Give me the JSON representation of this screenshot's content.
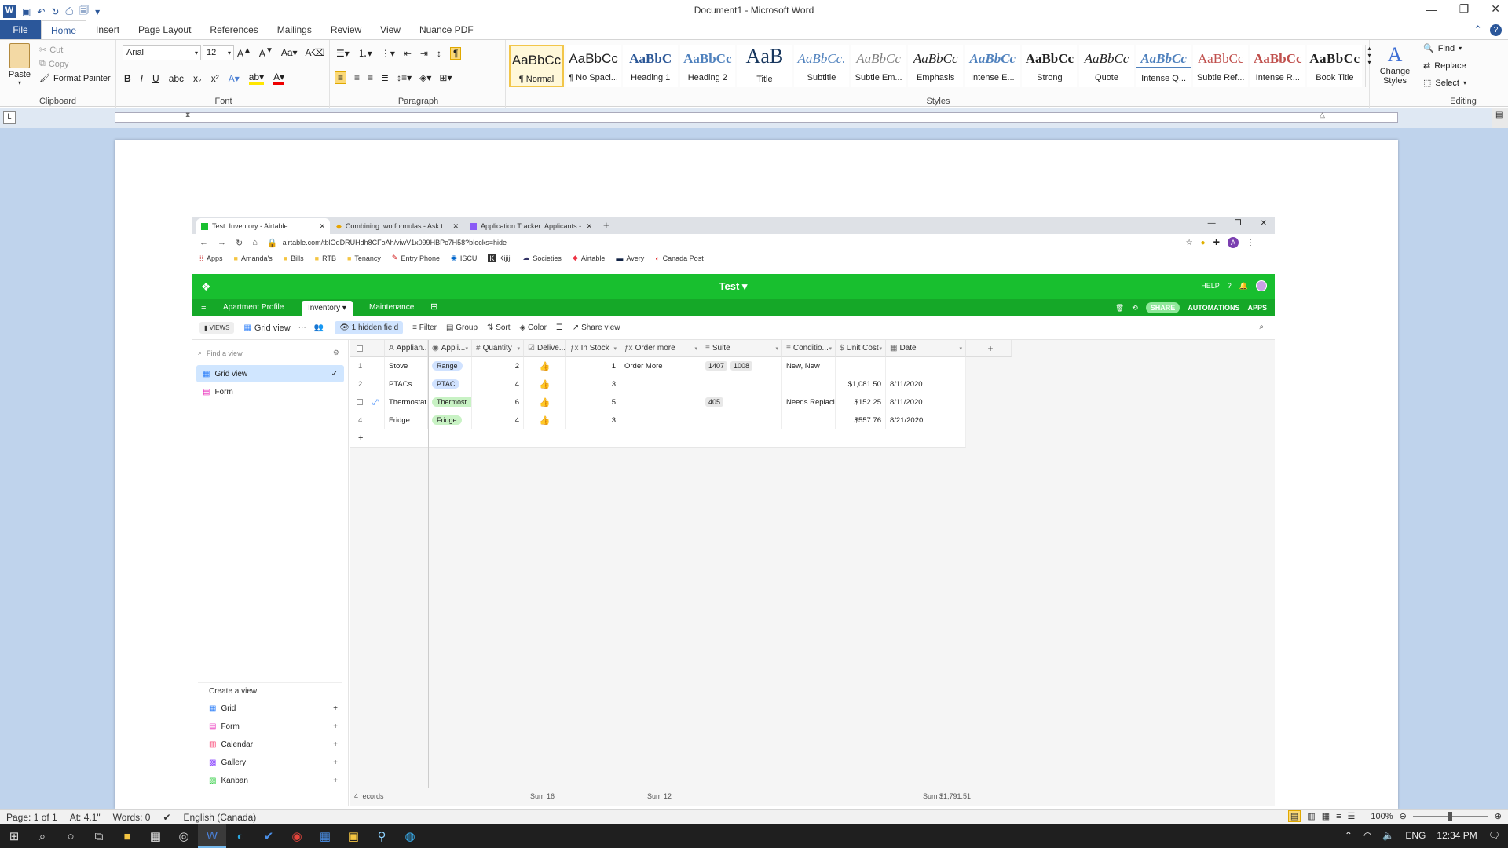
{
  "word": {
    "title": "Document1  -  Microsoft Word",
    "tabs": [
      "File",
      "Home",
      "Insert",
      "Page Layout",
      "References",
      "Mailings",
      "Review",
      "View",
      "Nuance PDF"
    ],
    "clipboard": {
      "paste": "Paste",
      "cut": "Cut",
      "copy": "Copy",
      "format_painter": "Format Painter",
      "label": "Clipboard"
    },
    "font": {
      "name": "Arial",
      "size": "12",
      "label": "Font"
    },
    "paragraph": {
      "label": "Paragraph"
    },
    "styles": {
      "label": "Styles",
      "items": [
        {
          "preview": "AaBbCc",
          "name": "¶ Normal"
        },
        {
          "preview": "AaBbCc",
          "name": "¶ No Spaci..."
        },
        {
          "preview": "AaBbC",
          "name": "Heading 1"
        },
        {
          "preview": "AaBbCc",
          "name": "Heading 2"
        },
        {
          "preview": "AaB",
          "name": "Title"
        },
        {
          "preview": "AaBbCc.",
          "name": "Subtitle"
        },
        {
          "preview": "AaBbCc",
          "name": "Subtle Em..."
        },
        {
          "preview": "AaBbCc",
          "name": "Emphasis"
        },
        {
          "preview": "AaBbCc",
          "name": "Intense E..."
        },
        {
          "preview": "AaBbCc",
          "name": "Strong"
        },
        {
          "preview": "AaBbCc",
          "name": "Quote"
        },
        {
          "preview": "AaBbCc",
          "name": "Intense Q..."
        },
        {
          "preview": "AaBbCc",
          "name": "Subtle Ref..."
        },
        {
          "preview": "AaBbCc",
          "name": "Intense R..."
        },
        {
          "preview": "AaBbCc",
          "name": "Book Title"
        }
      ]
    },
    "change_styles": "Change Styles",
    "editing": {
      "find": "Find",
      "replace": "Replace",
      "select": "Select",
      "label": "Editing"
    },
    "status": {
      "page": "Page: 1 of 1",
      "at": "At: 4.1\"",
      "words": "Words: 0",
      "language": "English (Canada)",
      "zoom": "100%"
    },
    "taskbar": {
      "lang": "ENG",
      "time": "12:34 PM"
    }
  },
  "browser": {
    "tabs": [
      "Test: Inventory - Airtable",
      "Combining two formulas - Ask t",
      "Application Tracker: Applicants -"
    ],
    "url": "airtable.com/tblOdDRUHdh8CFoAh/viwV1x099HBPc7H58?blocks=hide",
    "avatar": "A",
    "bookmarks": [
      "Apps",
      "Amanda's",
      "Bills",
      "RTB",
      "Tenancy",
      "Entry Phone",
      "ISCU",
      "Kijiji",
      "Societies",
      "Airtable",
      "Avery",
      "Canada Post"
    ]
  },
  "airtable": {
    "base_name": "Test",
    "help": "HELP",
    "tables": [
      "Apartment Profile",
      "Inventory",
      "Maintenance"
    ],
    "share": "SHARE",
    "automations": "AUTOMATIONS",
    "apps": "APPS",
    "views_label": "VIEWS",
    "view_name": "Grid view",
    "toolbar": {
      "hidden": "1 hidden field",
      "filter": "Filter",
      "group": "Group",
      "sort": "Sort",
      "color": "Color",
      "share_view": "Share view"
    },
    "find_view_placeholder": "Find a view",
    "views": [
      "Grid view",
      "Form"
    ],
    "create_view_label": "Create a view",
    "create_views": [
      "Grid",
      "Form",
      "Calendar",
      "Gallery",
      "Kanban"
    ],
    "columns": [
      "Applian...",
      "Appli...",
      "Quantity",
      "Delive...",
      "In Stock",
      "Order more",
      "Suite",
      "Conditio...",
      "Unit Cost",
      "Date"
    ],
    "rows": [
      {
        "n": "1",
        "name": "Stove",
        "type": "Range",
        "qty": "2",
        "in_stock": "1",
        "order": "Order More",
        "suite": [
          "1407",
          "1008"
        ],
        "cond": "New, New",
        "cost": "",
        "date": ""
      },
      {
        "n": "2",
        "name": "PTACs",
        "type": "PTAC",
        "qty": "4",
        "in_stock": "3",
        "order": "",
        "suite": [],
        "cond": "",
        "cost": "$1,081.50",
        "date": "8/11/2020"
      },
      {
        "n": "",
        "name": "Thermostat",
        "type": "Thermost...",
        "qty": "6",
        "in_stock": "5",
        "order": "",
        "suite": [
          "405"
        ],
        "cond": "Needs Replacing",
        "cost": "$152.25",
        "date": "8/11/2020"
      },
      {
        "n": "4",
        "name": "Fridge",
        "type": "Fridge",
        "qty": "4",
        "in_stock": "3",
        "order": "",
        "suite": [],
        "cond": "",
        "cost": "$557.76",
        "date": "8/21/2020"
      }
    ],
    "footer": {
      "records": "4 records",
      "sum_qty": "Sum  16",
      "sum_stock": "Sum  12",
      "sum_cost": "Sum  $1,791.51"
    }
  }
}
